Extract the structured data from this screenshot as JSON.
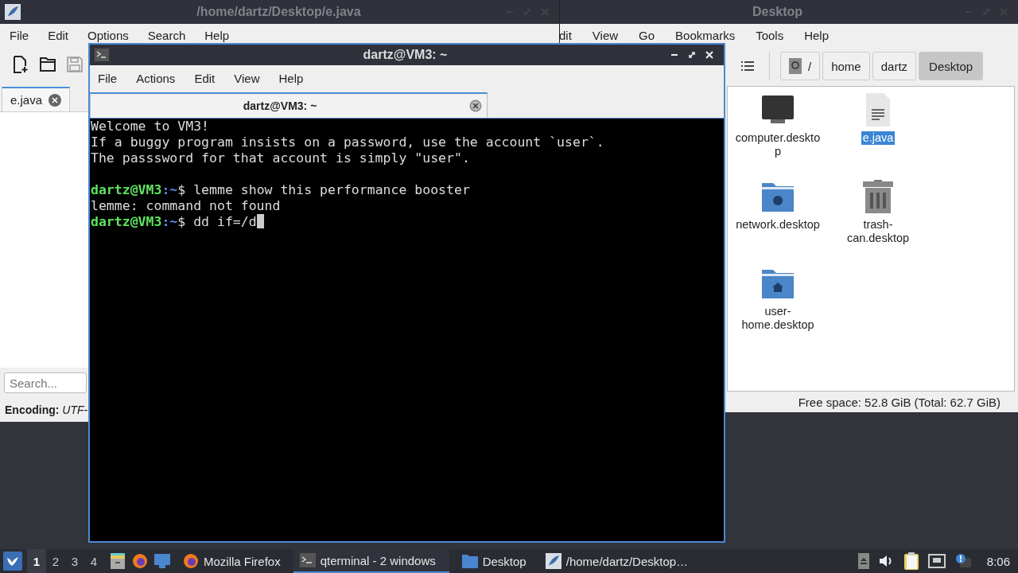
{
  "editor": {
    "title": "/home/dartz/Desktop/e.java",
    "menu": [
      "File",
      "Edit",
      "Options",
      "Search",
      "Help"
    ],
    "tabs": [
      {
        "label": "e.java",
        "selected": true
      }
    ],
    "search": {
      "placeholder": "Search..."
    },
    "status": {
      "label": "Encoding:",
      "value": "UTF-"
    }
  },
  "file_manager": {
    "title": "Desktop",
    "menu": [
      "dit",
      "View",
      "Go",
      "Bookmarks",
      "Tools",
      "Help"
    ],
    "path": [
      {
        "label": "/",
        "kind": "root",
        "selected": false
      },
      {
        "label": "home",
        "kind": "dir",
        "selected": false
      },
      {
        "label": "dartz",
        "kind": "dir",
        "selected": false
      },
      {
        "label": "Desktop",
        "kind": "dir",
        "selected": true
      }
    ],
    "files": [
      {
        "name": "computer.desktop",
        "kind": "computer",
        "selected": false
      },
      {
        "name": "e.java",
        "kind": "document",
        "selected": true
      },
      {
        "name": "network.desktop",
        "kind": "network",
        "selected": false
      },
      {
        "name": "trash-can.desktop",
        "kind": "trash",
        "selected": false
      },
      {
        "name": "user-home.desktop",
        "kind": "home",
        "selected": false
      }
    ],
    "status": "Free space: 52.8 GiB (Total: 62.7 GiB)"
  },
  "terminal": {
    "title": "dartz@VM3: ~",
    "menu": [
      "File",
      "Actions",
      "Edit",
      "View",
      "Help"
    ],
    "tabs": [
      {
        "label": "dartz@VM3: ~",
        "selected": true
      }
    ],
    "lines": [
      {
        "kind": "text",
        "text": "Welcome to VM3!"
      },
      {
        "kind": "text",
        "text": "If a buggy program insists on a password, use the account `user`."
      },
      {
        "kind": "text",
        "text": "The passsword for that account is simply \"user\"."
      },
      {
        "kind": "blank"
      },
      {
        "kind": "prompt",
        "user": "dartz@VM3",
        "path": ":~",
        "symbol": "$",
        "command": "lemme show this performance booster",
        "cursor": false
      },
      {
        "kind": "text",
        "text": "lemme: command not found"
      },
      {
        "kind": "prompt",
        "user": "dartz@VM3",
        "path": ":~",
        "symbol": "$",
        "command": "dd if=/d",
        "cursor": true
      }
    ]
  },
  "taskbar": {
    "workspaces": [
      {
        "label": "1",
        "selected": true
      },
      {
        "label": "2",
        "selected": false
      },
      {
        "label": "3",
        "selected": false
      },
      {
        "label": "4",
        "selected": false
      }
    ],
    "tasks": [
      {
        "label": "Mozilla Firefox",
        "kind": "firefox",
        "selected": false
      },
      {
        "label": "qterminal - 2 windows",
        "kind": "terminal",
        "selected": true
      },
      {
        "label": "Desktop",
        "kind": "folder",
        "selected": false
      },
      {
        "label": "/home/dartz/Desktop…",
        "kind": "editor",
        "selected": false
      }
    ],
    "clock": "8:06"
  }
}
